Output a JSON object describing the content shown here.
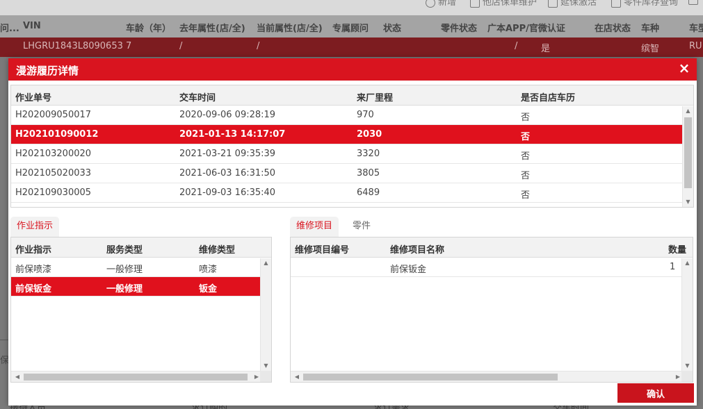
{
  "background": {
    "toolbar": [
      "新增",
      "他店保单维护",
      "延保激活",
      "零件库存查询"
    ],
    "header": [
      "问...",
      "VIN",
      "车龄（年）",
      "去年属性(店/全)",
      "当前属性(店/全)",
      "专属顾问",
      "状态",
      "零件状态",
      "广本APP/官微认证",
      "在店状态",
      "车种",
      "车型"
    ],
    "row": [
      "LHGRU1843L8090653",
      "7",
      "/",
      "/",
      "/",
      "是",
      "缤智",
      "RU"
    ],
    "side_label": "保",
    "bottom": [
      "接待人员",
      "求订购的",
      "求订需求",
      "交车时间"
    ]
  },
  "modal": {
    "title": "漫游履历详情",
    "close_icon": "×",
    "history": {
      "columns": [
        "作业单号",
        "交车时间",
        "来厂里程",
        "是否自店车历"
      ],
      "rows": [
        [
          "H202009050017",
          "2020-09-06 09:28:19",
          "970",
          "否"
        ],
        [
          "H202101090012",
          "2021-01-13 14:17:07",
          "2030",
          "否"
        ],
        [
          "H202103200020",
          "2021-03-21 09:35:39",
          "3320",
          "否"
        ],
        [
          "H202105020033",
          "2021-06-03 16:31:50",
          "3805",
          "否"
        ],
        [
          "H202109030005",
          "2021-09-03 16:35:40",
          "6489",
          "否"
        ]
      ],
      "selected_index": 1
    },
    "left_panel": {
      "tab": "作业指示",
      "columns": [
        "作业指示",
        "服务类型",
        "维修类型"
      ],
      "rows": [
        [
          "前保喷漆",
          "一般修理",
          "喷漆"
        ],
        [
          "前保钣金",
          "一般修理",
          "钣金"
        ]
      ],
      "selected_index": 1
    },
    "right_panel": {
      "tabs": [
        "维修项目",
        "零件"
      ],
      "active_tab": "维修项目",
      "columns": [
        "维修项目编号",
        "维修项目名称",
        "数量"
      ],
      "rows": [
        [
          "",
          "前保钣金",
          "1"
        ]
      ]
    },
    "confirm_label": "确认"
  },
  "colors": {
    "accent": "#d9141f",
    "selected_row": "#e0111d"
  }
}
